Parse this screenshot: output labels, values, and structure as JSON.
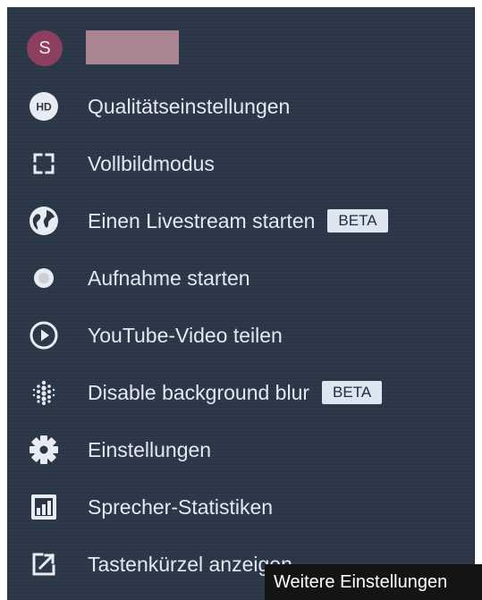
{
  "profile": {
    "avatar_initial": "S",
    "name_redacted": true
  },
  "menu": {
    "items": [
      {
        "label": "Qualitätseinstellungen",
        "icon": "hd-icon"
      },
      {
        "label": "Vollbildmodus",
        "icon": "fullscreen-icon"
      },
      {
        "label": "Einen Livestream starten",
        "icon": "globe-icon",
        "badge": "BETA"
      },
      {
        "label": "Aufnahme starten",
        "icon": "record-icon"
      },
      {
        "label": "YouTube-Video teilen",
        "icon": "play-circle-icon"
      },
      {
        "label": "Disable background blur",
        "icon": "blur-dots-icon",
        "badge": "BETA"
      },
      {
        "label": "Einstellungen",
        "icon": "gear-icon"
      },
      {
        "label": "Sprecher-Statistiken",
        "icon": "bar-chart-icon"
      },
      {
        "label": "Tastenkürzel anzeigen",
        "icon": "external-link-icon"
      }
    ]
  },
  "tooltip": {
    "text": "Weitere Einstellungen"
  },
  "colors": {
    "menu_bg": "#2a3546",
    "text": "#e4e8ef",
    "avatar": "#8c3f5e",
    "badge_bg": "#dde5f0",
    "tooltip_bg": "#141414"
  }
}
